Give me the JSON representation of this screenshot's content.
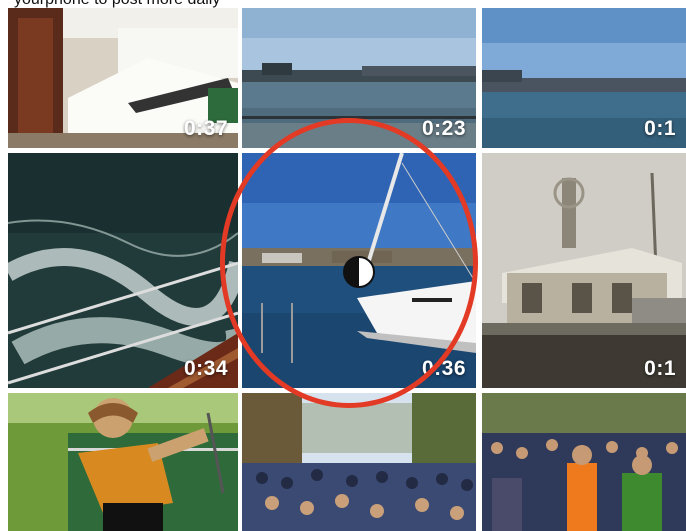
{
  "caption": "yourphone to post more daily",
  "grid": {
    "tiles": [
      {
        "duration": "0:37"
      },
      {
        "duration": "0:23"
      },
      {
        "duration": "0:1"
      },
      {
        "duration": ""
      },
      {
        "duration": "0:34"
      },
      {
        "duration": "0:36"
      },
      {
        "duration": "0:1"
      },
      {
        "duration": ""
      },
      {
        "duration": ""
      }
    ]
  },
  "highlight_color": "#e23a24"
}
